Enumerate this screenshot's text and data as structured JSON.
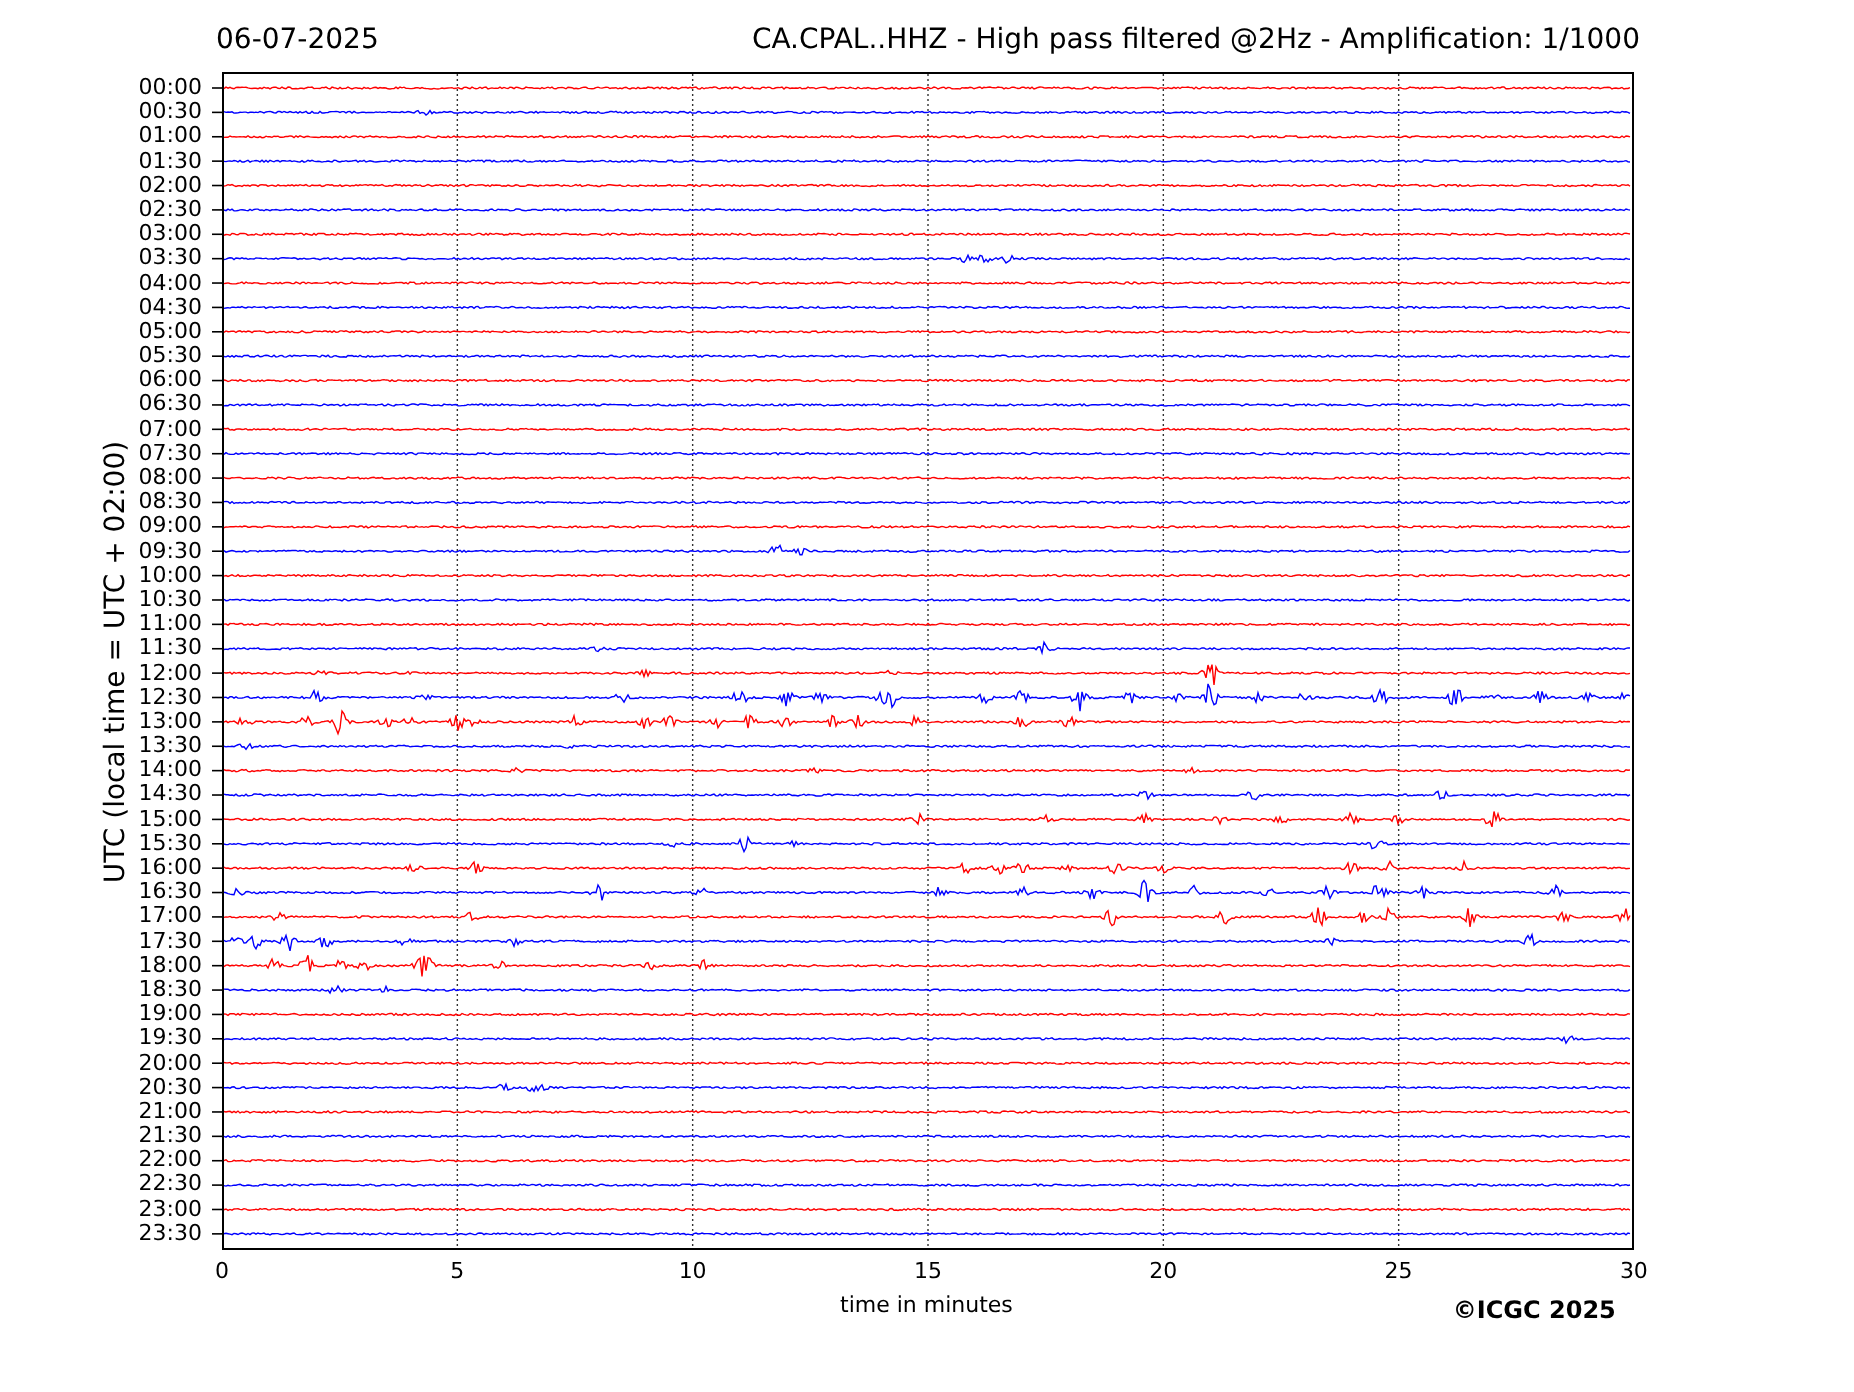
{
  "header": {
    "date": "06-07-2025",
    "title": "CA.CPAL..HHZ - High pass filtered @2Hz - Amplification: 1/1000"
  },
  "plot": {
    "ylabel": "UTC (local time = UTC + 02:00)",
    "xlabel": "time in minutes",
    "xticks": [
      "0",
      "5",
      "10",
      "15",
      "20",
      "25",
      "30"
    ],
    "rows": [
      {
        "label": "00:00",
        "color": "#ff0000"
      },
      {
        "label": "00:30",
        "color": "#0000ff"
      },
      {
        "label": "01:00",
        "color": "#ff0000"
      },
      {
        "label": "01:30",
        "color": "#0000ff"
      },
      {
        "label": "02:00",
        "color": "#ff0000"
      },
      {
        "label": "02:30",
        "color": "#0000ff"
      },
      {
        "label": "03:00",
        "color": "#ff0000"
      },
      {
        "label": "03:30",
        "color": "#0000ff"
      },
      {
        "label": "04:00",
        "color": "#ff0000"
      },
      {
        "label": "04:30",
        "color": "#0000ff"
      },
      {
        "label": "05:00",
        "color": "#ff0000"
      },
      {
        "label": "05:30",
        "color": "#0000ff"
      },
      {
        "label": "06:00",
        "color": "#ff0000"
      },
      {
        "label": "06:30",
        "color": "#0000ff"
      },
      {
        "label": "07:00",
        "color": "#ff0000"
      },
      {
        "label": "07:30",
        "color": "#0000ff"
      },
      {
        "label": "08:00",
        "color": "#ff0000"
      },
      {
        "label": "08:30",
        "color": "#0000ff"
      },
      {
        "label": "09:00",
        "color": "#ff0000"
      },
      {
        "label": "09:30",
        "color": "#0000ff"
      },
      {
        "label": "10:00",
        "color": "#ff0000"
      },
      {
        "label": "10:30",
        "color": "#0000ff"
      },
      {
        "label": "11:00",
        "color": "#ff0000"
      },
      {
        "label": "11:30",
        "color": "#0000ff"
      },
      {
        "label": "12:00",
        "color": "#ff0000"
      },
      {
        "label": "12:30",
        "color": "#0000ff"
      },
      {
        "label": "13:00",
        "color": "#ff0000"
      },
      {
        "label": "13:30",
        "color": "#0000ff"
      },
      {
        "label": "14:00",
        "color": "#ff0000"
      },
      {
        "label": "14:30",
        "color": "#0000ff"
      },
      {
        "label": "15:00",
        "color": "#ff0000"
      },
      {
        "label": "15:30",
        "color": "#0000ff"
      },
      {
        "label": "16:00",
        "color": "#ff0000"
      },
      {
        "label": "16:30",
        "color": "#0000ff"
      },
      {
        "label": "17:00",
        "color": "#ff0000"
      },
      {
        "label": "17:30",
        "color": "#0000ff"
      },
      {
        "label": "18:00",
        "color": "#ff0000"
      },
      {
        "label": "18:30",
        "color": "#0000ff"
      },
      {
        "label": "19:00",
        "color": "#ff0000"
      },
      {
        "label": "19:30",
        "color": "#0000ff"
      },
      {
        "label": "20:00",
        "color": "#ff0000"
      },
      {
        "label": "20:30",
        "color": "#0000ff"
      },
      {
        "label": "21:00",
        "color": "#ff0000"
      },
      {
        "label": "21:30",
        "color": "#0000ff"
      },
      {
        "label": "22:00",
        "color": "#ff0000"
      },
      {
        "label": "22:30",
        "color": "#0000ff"
      },
      {
        "label": "23:00",
        "color": "#ff0000"
      },
      {
        "label": "23:30",
        "color": "#0000ff"
      }
    ]
  },
  "footer": {
    "copyright": "©ICGC 2025"
  }
}
